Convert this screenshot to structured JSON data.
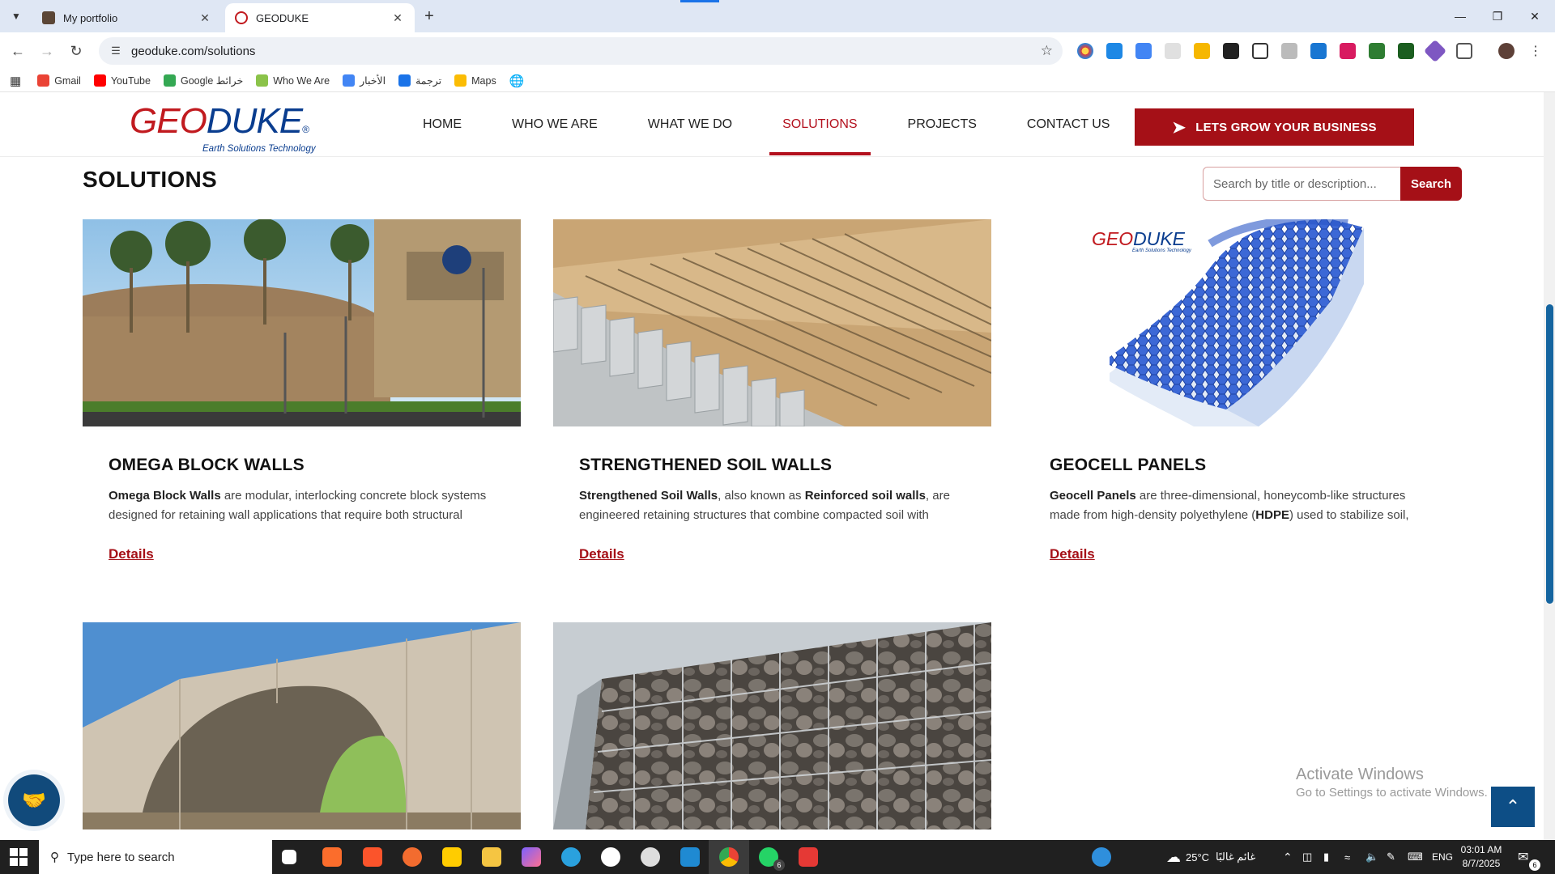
{
  "browser": {
    "tabs": [
      {
        "title": "My portfolio",
        "active": false
      },
      {
        "title": "GEODUKE",
        "active": true
      }
    ],
    "url": "geoduke.com/solutions",
    "bookmarks": [
      {
        "label": "Gmail"
      },
      {
        "label": "YouTube"
      },
      {
        "label": "Google خرائط"
      },
      {
        "label": "Who We Are"
      },
      {
        "label": "الأخبار"
      },
      {
        "label": "ترجمة"
      },
      {
        "label": "Maps"
      }
    ]
  },
  "site": {
    "logo_part1": "GEO",
    "logo_part2": "DUKE",
    "logo_tagline": "Earth Solutions Technology",
    "nav": [
      {
        "label": "HOME",
        "active": false
      },
      {
        "label": "WHO WE ARE",
        "active": false
      },
      {
        "label": "WHAT WE DO",
        "active": false
      },
      {
        "label": "SOLUTIONS",
        "active": true
      },
      {
        "label": "PROJECTS",
        "active": false
      },
      {
        "label": "CONTACT US",
        "active": false
      }
    ],
    "cta": "LETS GROW YOUR BUSINESS",
    "accent": "#a51017",
    "brand_blue": "#0a3d8f"
  },
  "solutions": {
    "title": "SOLUTIONS",
    "search_placeholder": "Search by title or description...",
    "search_button": "Search",
    "cards": [
      {
        "title": "OMEGA BLOCK WALLS",
        "bold_lead": "Omega Block Walls",
        "desc_rest": " are modular, interlocking concrete block systems designed for retaining wall applications that require both structural stability...",
        "link": "Details"
      },
      {
        "title": "STRENGTHENED SOIL WALLS",
        "bold_lead": "Strengthened Soil Walls",
        "desc_mid": ", also known as ",
        "bold_mid": "Reinforced soil walls",
        "desc_rest": ", are engineered retaining structures that combine compacted soil with tensile...",
        "link": "Details"
      },
      {
        "title": "GEOCELL PANELS",
        "bold_lead": "Geocell Panels",
        "desc_mid": " are three-dimensional, honeycomb-like structures made from high-density polyethylene (",
        "bold_mid": "HDPE",
        "desc_rest": ") used to stabilize soil, control...",
        "link": "Details",
        "image_logo_part1": "GEO",
        "image_logo_part2": "DUKE",
        "image_logo_tagline": "Earth Solutions Technology"
      }
    ]
  },
  "overlay": {
    "activate_title": "Activate Windows",
    "activate_sub": "Go to Settings to activate Windows."
  },
  "taskbar": {
    "search_placeholder": "Type here to search",
    "weather": "25°C",
    "weather_text": "غائم غالبًا",
    "lang": "ENG",
    "time": "03:01 AM",
    "date": "8/7/2025",
    "whatsapp_badge": "6",
    "notif_badge": "6"
  }
}
